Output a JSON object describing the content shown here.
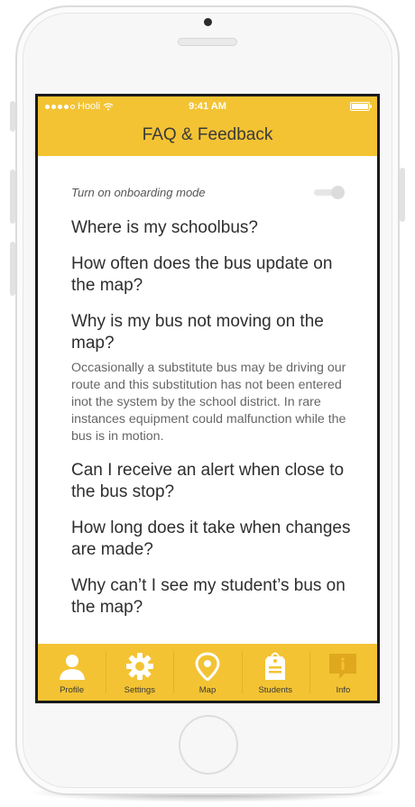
{
  "status_bar": {
    "carrier": "Hooli",
    "time": "9:41 AM"
  },
  "header": {
    "title": "FAQ & Feedback"
  },
  "onboarding": {
    "label": "Turn on onboarding mode",
    "enabled": true
  },
  "faq": [
    {
      "question": "Where is my schoolbus?",
      "answer": ""
    },
    {
      "question": "How often does the bus update on the map?",
      "answer": ""
    },
    {
      "question": "Why is my bus not moving on the map?",
      "answer": "Occasionally a substitute bus may be driving our route and this substitution has not been entered inot the system by the school district. In rare instances equipment could malfunction while the bus is in motion."
    },
    {
      "question": "Can I receive an alert when close to the bus stop?",
      "answer": ""
    },
    {
      "question": "How long does it take when changes are made?",
      "answer": ""
    },
    {
      "question": "Why can’t I see my student’s bus on the map?",
      "answer": ""
    }
  ],
  "tabs": [
    {
      "label": "Profile",
      "icon": "person-icon"
    },
    {
      "label": "Settings",
      "icon": "gear-icon"
    },
    {
      "label": "Map",
      "icon": "map-pin-icon"
    },
    {
      "label": "Students",
      "icon": "luggage-tag-icon"
    },
    {
      "label": "Info",
      "icon": "info-bubble-icon"
    }
  ],
  "colors": {
    "accent": "#f3c333",
    "icon": "#ffffff",
    "active_icon": "#e0a81e"
  }
}
